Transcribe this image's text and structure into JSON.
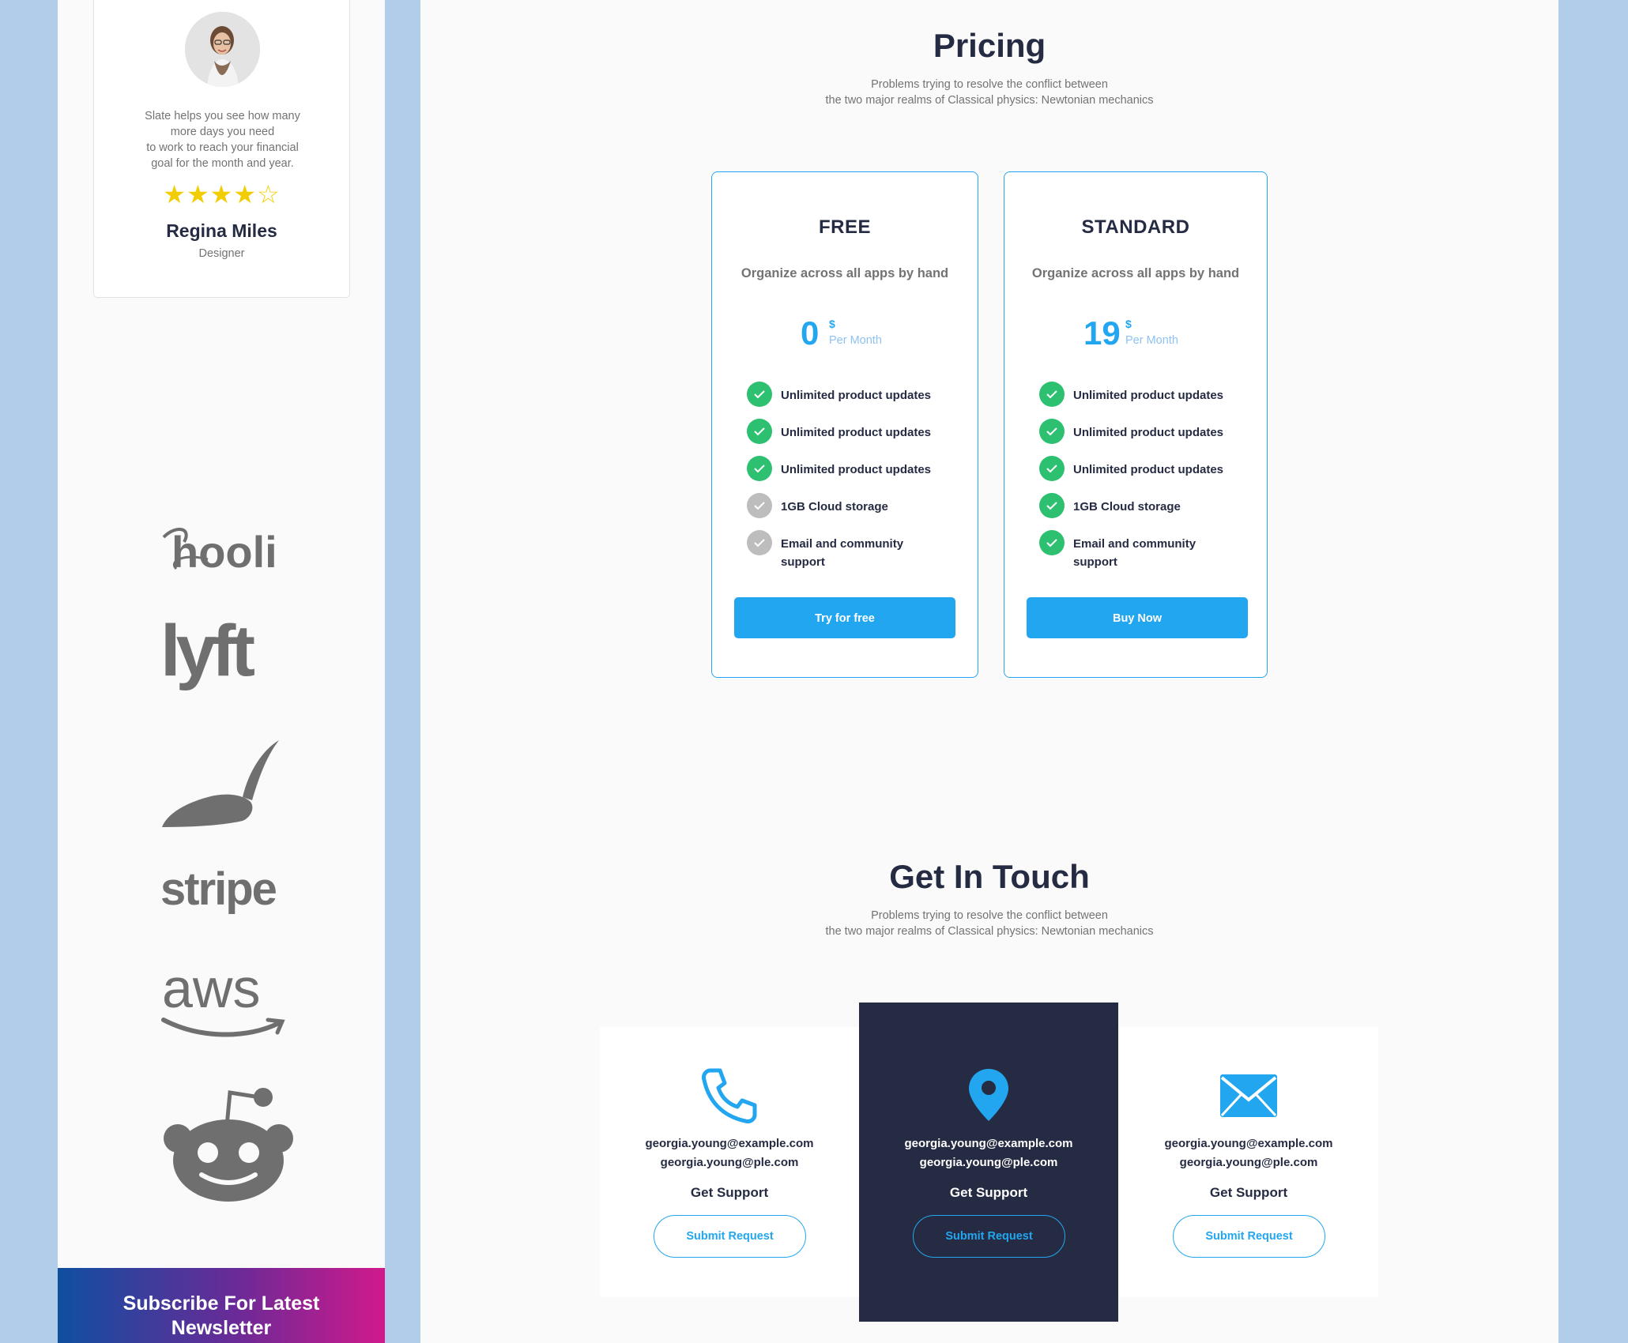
{
  "testimonial": {
    "quote_lines": [
      "Slate helps you see how many",
      "more days you need",
      "to work to reach your financial",
      "goal for the month and year."
    ],
    "rating": 4,
    "rating_max": 5,
    "name": "Regina Miles",
    "role": "Designer"
  },
  "brand_logos": [
    {
      "label": "hooli",
      "icon": "hooli-logo"
    },
    {
      "label": "lyft",
      "icon": "lyft-logo"
    },
    {
      "label": "",
      "icon": "feather-hat-logo"
    },
    {
      "label": "stripe",
      "icon": "stripe-logo"
    },
    {
      "label": "aws",
      "icon": "aws-logo"
    },
    {
      "label": "",
      "icon": "reddit-logo"
    }
  ],
  "newsletter": {
    "line1": "Subscribe For Latest",
    "line2": "Newsletter"
  },
  "pricing": {
    "title": "Pricing",
    "subtitle_lines": [
      "Problems trying to resolve the conflict between",
      "the two major realms of Classical physics: Newtonian mechanics"
    ],
    "plans": [
      {
        "name": "FREE",
        "description": "Organize across all apps by hand",
        "price": "0",
        "currency": "$",
        "period": "Per Month",
        "features": [
          {
            "text": "Unlimited product updates",
            "included": true
          },
          {
            "text": "Unlimited product updates",
            "included": true
          },
          {
            "text": "Unlimited product updates",
            "included": true
          },
          {
            "text": "1GB  Cloud storage",
            "included": false
          },
          {
            "text": "Email and community support",
            "included": false
          }
        ],
        "button": "Try for free"
      },
      {
        "name": "STANDARD",
        "description": "Organize across all apps by hand",
        "price": "19",
        "currency": "$",
        "period": "Per Month",
        "features": [
          {
            "text": "Unlimited product updates",
            "included": true
          },
          {
            "text": "Unlimited product updates",
            "included": true
          },
          {
            "text": "Unlimited product updates",
            "included": true
          },
          {
            "text": "1GB  Cloud storage",
            "included": true
          },
          {
            "text": "Email and community support",
            "included": true
          }
        ],
        "button": "Buy Now"
      }
    ]
  },
  "contact": {
    "title": "Get In Touch",
    "subtitle_lines": [
      "Problems trying to resolve the conflict between",
      "the two major realms of Classical physics: Newtonian mechanics"
    ],
    "cards": [
      {
        "icon": "phone-icon",
        "email1": "georgia.young@example.com",
        "email2": "georgia.young@ple.com",
        "heading": "Get Support",
        "button": "Submit Request",
        "highlighted": false
      },
      {
        "icon": "location-pin-icon",
        "email1": "georgia.young@example.com",
        "email2": "georgia.young@ple.com",
        "heading": "Get Support",
        "button": "Submit Request",
        "highlighted": true
      },
      {
        "icon": "mail-icon",
        "email1": "georgia.young@example.com",
        "email2": "georgia.young@ple.com",
        "heading": "Get Support",
        "button": "Submit Request",
        "highlighted": false
      }
    ]
  },
  "colors": {
    "primary": "#23a6f0",
    "success": "#2dc071",
    "muted_check": "#bdbdbd",
    "dark": "#252b42",
    "star": "#f3cd03",
    "outer_background": "#b2cde9"
  }
}
